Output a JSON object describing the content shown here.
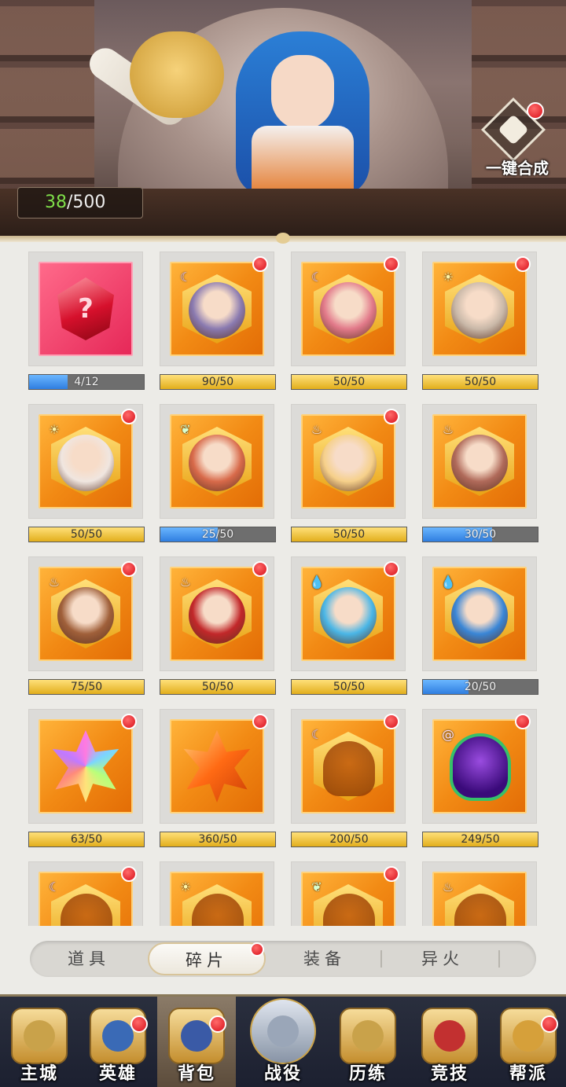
{
  "banner": {
    "shard_count": "38",
    "shard_capacity": "/500",
    "merge_label": "一键合成",
    "merge_icon": "puzzle-icon"
  },
  "colors": {
    "gold_bar": "#e2ae1c",
    "blue_bar": "#2f7ee0",
    "tile_orange": "#f28a14",
    "red_dot": "#d8101a",
    "counter_green": "#7fe04a"
  },
  "grid": {
    "items": [
      {
        "kind": "ruby",
        "element": "",
        "progress": "4/12",
        "fill": 0.333,
        "bar": "blue",
        "dot": false
      },
      {
        "kind": "portrait",
        "element": "moon",
        "progress": "90/50",
        "fill": 1,
        "bar": "gold",
        "dot": true,
        "tone": "#8a7ab0"
      },
      {
        "kind": "portrait",
        "element": "moon",
        "progress": "50/50",
        "fill": 1,
        "bar": "gold",
        "dot": true,
        "tone": "#e27a8a"
      },
      {
        "kind": "portrait",
        "element": "sun",
        "progress": "50/50",
        "fill": 1,
        "bar": "gold",
        "dot": true,
        "tone": "#c9b8a8"
      },
      {
        "kind": "portrait",
        "element": "sun",
        "progress": "50/50",
        "fill": 1,
        "bar": "gold",
        "dot": true,
        "tone": "#f0e6e0"
      },
      {
        "kind": "portrait",
        "element": "leaf",
        "progress": "25/50",
        "fill": 0.5,
        "bar": "blue",
        "dot": false,
        "tone": "#d86a4a"
      },
      {
        "kind": "portrait",
        "element": "fire",
        "progress": "50/50",
        "fill": 1,
        "bar": "gold",
        "dot": true,
        "tone": "#f6d08a"
      },
      {
        "kind": "portrait",
        "element": "fire",
        "progress": "30/50",
        "fill": 0.6,
        "bar": "blue",
        "dot": false,
        "tone": "#b06a5a"
      },
      {
        "kind": "portrait",
        "element": "fire",
        "progress": "75/50",
        "fill": 1,
        "bar": "gold",
        "dot": true,
        "tone": "#a0603a"
      },
      {
        "kind": "portrait",
        "element": "fire",
        "progress": "50/50",
        "fill": 1,
        "bar": "gold",
        "dot": true,
        "tone": "#c2282a"
      },
      {
        "kind": "portrait",
        "element": "water",
        "progress": "50/50",
        "fill": 1,
        "bar": "gold",
        "dot": true,
        "tone": "#4ab6e6"
      },
      {
        "kind": "portrait",
        "element": "water",
        "progress": "20/50",
        "fill": 0.4,
        "bar": "blue",
        "dot": false,
        "tone": "#3a86d6"
      },
      {
        "kind": "star-rainbow",
        "element": "",
        "progress": "63/50",
        "fill": 1,
        "bar": "gold",
        "dot": true
      },
      {
        "kind": "star-orange",
        "element": "",
        "progress": "360/50",
        "fill": 1,
        "bar": "gold",
        "dot": true
      },
      {
        "kind": "silhouette",
        "element": "moon",
        "progress": "200/50",
        "fill": 1,
        "bar": "gold",
        "dot": true
      },
      {
        "kind": "gem",
        "element": "swirl",
        "progress": "249/50",
        "fill": 1,
        "bar": "gold",
        "dot": true
      },
      {
        "kind": "silhouette",
        "element": "moon",
        "progress": "",
        "fill": 0,
        "bar": "gold",
        "dot": true
      },
      {
        "kind": "silhouette",
        "element": "sun",
        "progress": "",
        "fill": 0,
        "bar": "gold",
        "dot": false
      },
      {
        "kind": "silhouette",
        "element": "leaf",
        "progress": "",
        "fill": 0,
        "bar": "gold",
        "dot": true
      },
      {
        "kind": "silhouette",
        "element": "fire",
        "progress": "",
        "fill": 0,
        "bar": "gold",
        "dot": false
      }
    ]
  },
  "tabs": [
    {
      "label": "道具",
      "active": false,
      "dot": false
    },
    {
      "label": "碎片",
      "active": true,
      "dot": true
    },
    {
      "label": "装备",
      "active": false,
      "dot": false
    },
    {
      "label": "异火",
      "active": false,
      "dot": false
    }
  ],
  "nav": [
    {
      "label": "主城",
      "icon": "castle-icon",
      "active": false,
      "dot": false
    },
    {
      "label": "英雄",
      "icon": "hero-helmet-icon",
      "active": false,
      "dot": true
    },
    {
      "label": "背包",
      "icon": "backpack-icon",
      "active": true,
      "dot": true
    },
    {
      "label": "战役",
      "icon": "crossed-swords-icon",
      "active": false,
      "dot": false
    },
    {
      "label": "历练",
      "icon": "tower-icon",
      "active": false,
      "dot": false
    },
    {
      "label": "竞技",
      "icon": "arena-shield-icon",
      "active": false,
      "dot": false
    },
    {
      "label": "帮派",
      "icon": "guild-crest-icon",
      "active": false,
      "dot": true
    }
  ]
}
